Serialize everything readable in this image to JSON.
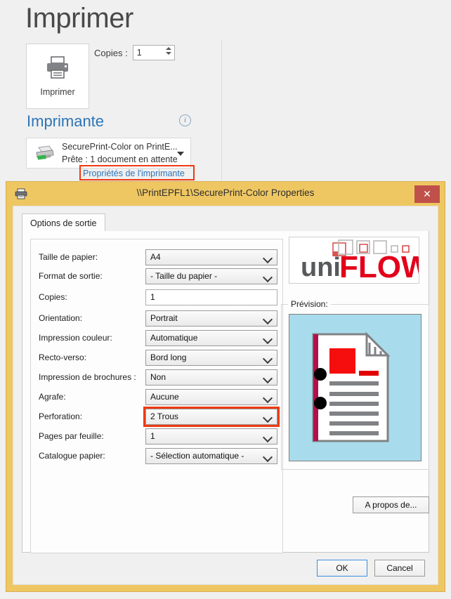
{
  "backstage": {
    "title": "Imprimer",
    "print_button_label": "Imprimer",
    "copies_label": "Copies :",
    "copies_value": "1",
    "printer_section_title": "Imprimante",
    "printer_name": "SecurePrint-Color on PrintE...",
    "printer_status": "Prête : 1 document en attente",
    "properties_link": "Propriétés de l'imprimante",
    "accent_blue": "#2e75b6",
    "highlight_red": "#ee3a12"
  },
  "dialog": {
    "title": "\\\\PrintEPFL1\\SecurePrint-Color Properties",
    "titlebar_color": "#efc762",
    "close_label": "✕",
    "tab_label": "Options de sortie",
    "fields": [
      {
        "label": "Taille de papier:",
        "value": "A4",
        "type": "select"
      },
      {
        "label": "Format de sortie:",
        "value": "- Taille du papier -",
        "type": "select"
      },
      {
        "label": "Copies:",
        "value": "1",
        "type": "text"
      },
      {
        "label": "Orientation:",
        "value": "Portrait",
        "type": "select"
      },
      {
        "label": "Impression couleur:",
        "value": "Automatique",
        "type": "select"
      },
      {
        "label": "Recto-verso:",
        "value": "Bord long",
        "type": "select"
      },
      {
        "label": "Impression de brochures :",
        "value": "Non",
        "type": "select"
      },
      {
        "label": "Agrafe:",
        "value": "Aucune",
        "type": "select"
      },
      {
        "label": "Perforation:",
        "value": "2 Trous",
        "type": "select",
        "highlighted": true
      },
      {
        "label": "Pages par feuille:",
        "value": "1",
        "type": "select"
      },
      {
        "label": "Catalogue papier:",
        "value": "- Sélection automatique -",
        "type": "select"
      }
    ],
    "logo": {
      "text_left": "uni",
      "text_right": "FLOW",
      "red": "#e2001a",
      "gray": "#58595b"
    },
    "preview_group_label": "Prévision:",
    "preview_bg": "#a8dcec",
    "about_button": "A propos de...",
    "ok_button": "OK",
    "cancel_button": "Cancel"
  }
}
